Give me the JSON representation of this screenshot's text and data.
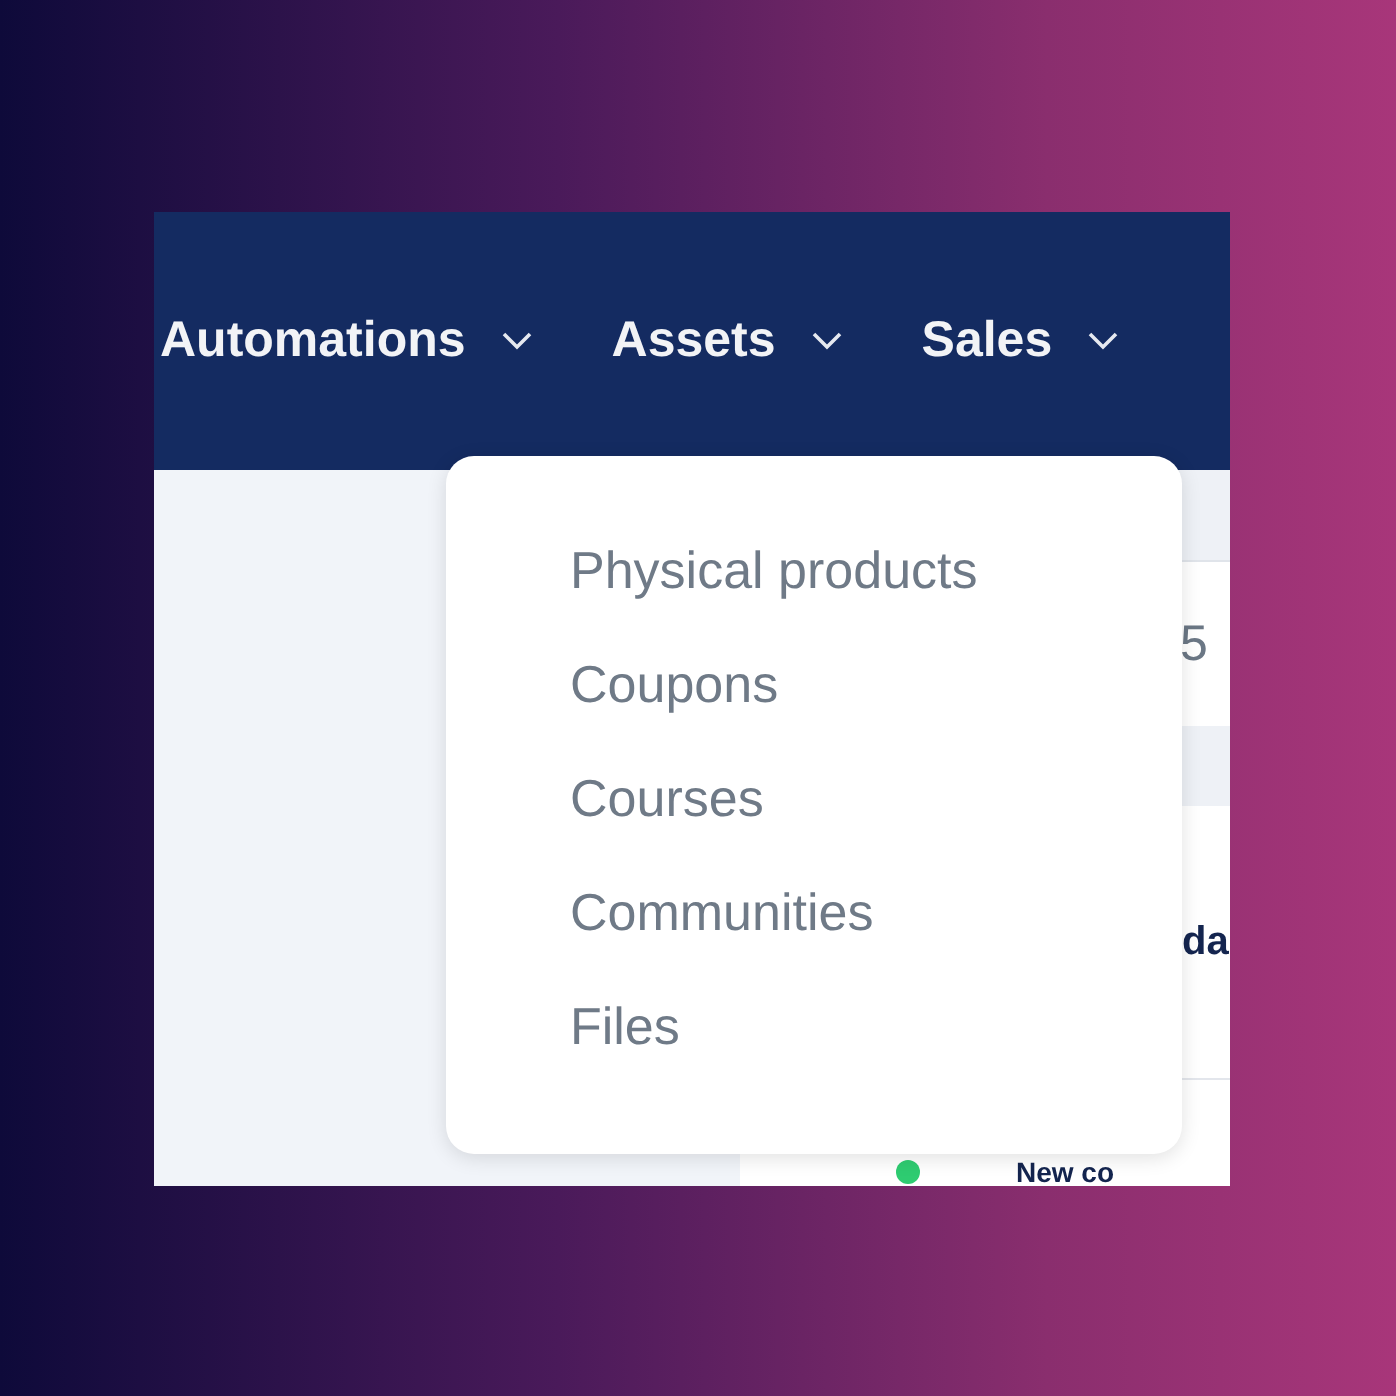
{
  "nav": [
    {
      "label": "Automations"
    },
    {
      "label": "Assets"
    },
    {
      "label": "Sales"
    }
  ],
  "dropdown": {
    "items": [
      "Physical products",
      "Coupons",
      "Courses",
      "Communities",
      "Files"
    ]
  },
  "content": {
    "range_text": "5",
    "heading": "da",
    "activity_text": "New co"
  }
}
